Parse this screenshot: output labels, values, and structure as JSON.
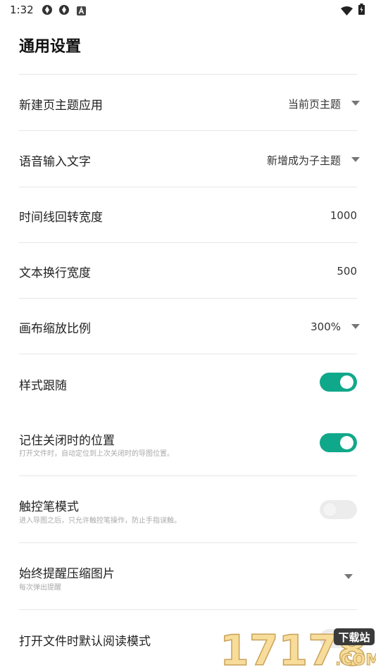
{
  "status_bar": {
    "time": "1:32"
  },
  "page": {
    "title": "通用设置"
  },
  "settings": [
    {
      "label": "新建页主题应用",
      "value": "当前页主题"
    },
    {
      "label": "语音输入文字",
      "value": "新增成为子主题"
    },
    {
      "label": "时间线回转宽度",
      "value": "1000"
    },
    {
      "label": "文本换行宽度",
      "value": "500"
    },
    {
      "label": "画布缩放比例",
      "value": "300%"
    },
    {
      "label": "样式跟随",
      "enabled": true
    },
    {
      "label": "记住关闭时的位置",
      "description": "打开文件时，自动定位到上次关闭时的导图位置。",
      "enabled": true
    },
    {
      "label": "触控笔模式",
      "description": "进入导图之后，只允许触控笔操作，防止手指误触。",
      "enabled": false
    },
    {
      "label": "始终提醒压缩图片",
      "description": "每次弹出提醒"
    },
    {
      "label": "打开文件时默认阅读模式"
    }
  ],
  "watermark": {
    "text": "17178",
    "badge": "下载站",
    "domain": ".COM"
  },
  "colors": {
    "accent": "#10a88a",
    "divider": "#e6e6e6"
  }
}
